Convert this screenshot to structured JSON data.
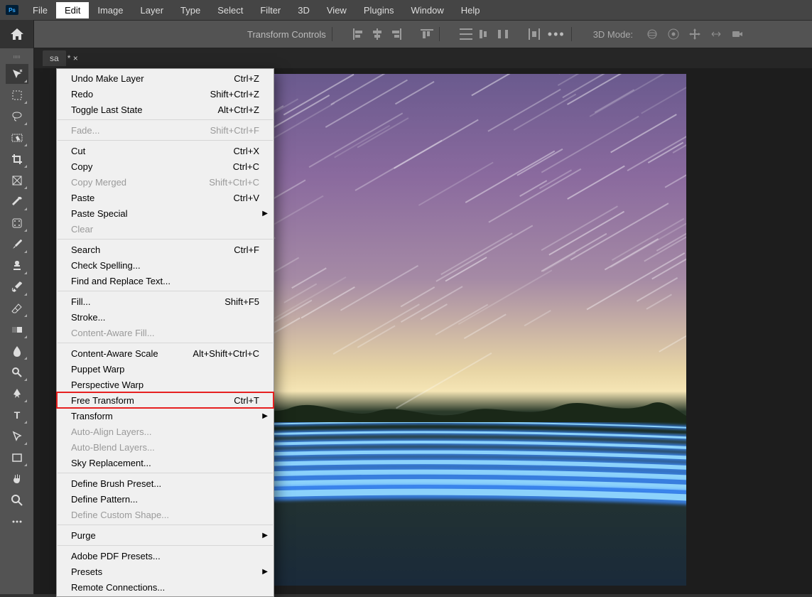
{
  "menubar": {
    "items": [
      "File",
      "Edit",
      "Image",
      "Layer",
      "Type",
      "Select",
      "Filter",
      "3D",
      "View",
      "Plugins",
      "Window",
      "Help"
    ],
    "activeIndex": 1,
    "psLabel": "Ps"
  },
  "optionsbar": {
    "transformText": "Transform Controls",
    "mode3d": "3D Mode:"
  },
  "tab": {
    "label": "* ×",
    "prefix": "sa"
  },
  "dropdown": {
    "groups": [
      [
        {
          "label": "Undo Make Layer",
          "shortcut": "Ctrl+Z",
          "disabled": false
        },
        {
          "label": "Redo",
          "shortcut": "Shift+Ctrl+Z",
          "disabled": false
        },
        {
          "label": "Toggle Last State",
          "shortcut": "Alt+Ctrl+Z",
          "disabled": false
        }
      ],
      [
        {
          "label": "Fade...",
          "shortcut": "Shift+Ctrl+F",
          "disabled": true
        }
      ],
      [
        {
          "label": "Cut",
          "shortcut": "Ctrl+X",
          "disabled": false
        },
        {
          "label": "Copy",
          "shortcut": "Ctrl+C",
          "disabled": false
        },
        {
          "label": "Copy Merged",
          "shortcut": "Shift+Ctrl+C",
          "disabled": true
        },
        {
          "label": "Paste",
          "shortcut": "Ctrl+V",
          "disabled": false
        },
        {
          "label": "Paste Special",
          "shortcut": "",
          "disabled": false,
          "submenu": true
        },
        {
          "label": "Clear",
          "shortcut": "",
          "disabled": true
        }
      ],
      [
        {
          "label": "Search",
          "shortcut": "Ctrl+F",
          "disabled": false
        },
        {
          "label": "Check Spelling...",
          "shortcut": "",
          "disabled": false
        },
        {
          "label": "Find and Replace Text...",
          "shortcut": "",
          "disabled": false
        }
      ],
      [
        {
          "label": "Fill...",
          "shortcut": "Shift+F5",
          "disabled": false
        },
        {
          "label": "Stroke...",
          "shortcut": "",
          "disabled": false
        },
        {
          "label": "Content-Aware Fill...",
          "shortcut": "",
          "disabled": true
        }
      ],
      [
        {
          "label": "Content-Aware Scale",
          "shortcut": "Alt+Shift+Ctrl+C",
          "disabled": false
        },
        {
          "label": "Puppet Warp",
          "shortcut": "",
          "disabled": false
        },
        {
          "label": "Perspective Warp",
          "shortcut": "",
          "disabled": false
        },
        {
          "label": "Free Transform",
          "shortcut": "Ctrl+T",
          "disabled": false,
          "highlight": true
        },
        {
          "label": "Transform",
          "shortcut": "",
          "disabled": false,
          "submenu": true
        },
        {
          "label": "Auto-Align Layers...",
          "shortcut": "",
          "disabled": true
        },
        {
          "label": "Auto-Blend Layers...",
          "shortcut": "",
          "disabled": true
        },
        {
          "label": "Sky Replacement...",
          "shortcut": "",
          "disabled": false
        }
      ],
      [
        {
          "label": "Define Brush Preset...",
          "shortcut": "",
          "disabled": false
        },
        {
          "label": "Define Pattern...",
          "shortcut": "",
          "disabled": false
        },
        {
          "label": "Define Custom Shape...",
          "shortcut": "",
          "disabled": true
        }
      ],
      [
        {
          "label": "Purge",
          "shortcut": "",
          "disabled": false,
          "submenu": true
        }
      ],
      [
        {
          "label": "Adobe PDF Presets...",
          "shortcut": "",
          "disabled": false
        },
        {
          "label": "Presets",
          "shortcut": "",
          "disabled": false,
          "submenu": true
        },
        {
          "label": "Remote Connections...",
          "shortcut": "",
          "disabled": false
        }
      ]
    ]
  },
  "tools": [
    {
      "name": "move-tool",
      "active": true
    },
    {
      "name": "marquee-tool"
    },
    {
      "name": "lasso-tool"
    },
    {
      "name": "object-select-tool"
    },
    {
      "name": "crop-tool"
    },
    {
      "name": "frame-tool"
    },
    {
      "name": "eyedropper-tool"
    },
    {
      "name": "healing-brush-tool"
    },
    {
      "name": "brush-tool"
    },
    {
      "name": "stamp-tool"
    },
    {
      "name": "history-brush-tool"
    },
    {
      "name": "eraser-tool"
    },
    {
      "name": "gradient-tool"
    },
    {
      "name": "blur-tool"
    },
    {
      "name": "dodge-tool"
    },
    {
      "name": "pen-tool"
    },
    {
      "name": "type-tool"
    },
    {
      "name": "path-select-tool"
    },
    {
      "name": "rectangle-tool"
    },
    {
      "name": "hand-tool"
    },
    {
      "name": "zoom-tool"
    },
    {
      "name": "more-tool"
    }
  ]
}
